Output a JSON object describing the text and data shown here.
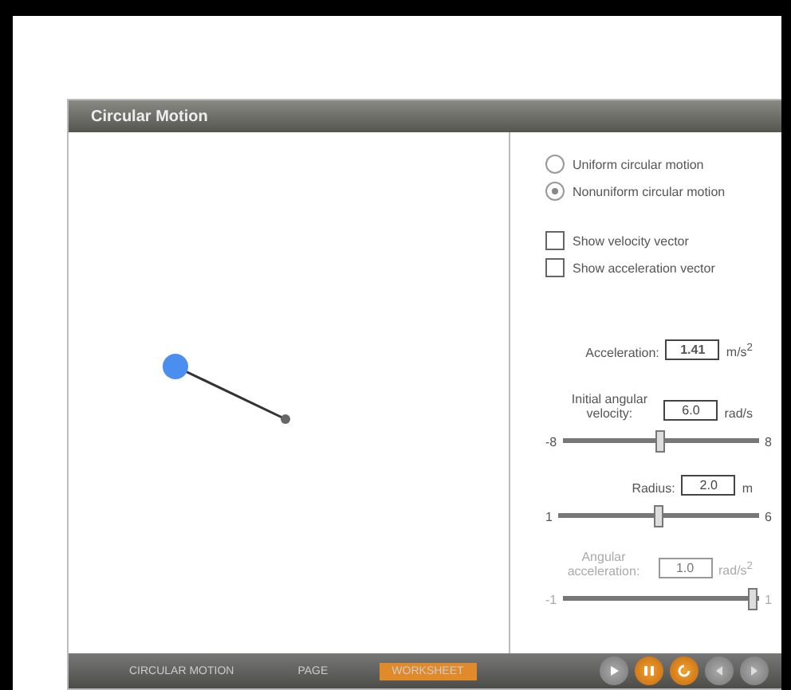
{
  "window": {
    "title": "Circular Motion"
  },
  "motion_modes": [
    {
      "label": "Uniform circular motion",
      "selected": false
    },
    {
      "label": "Nonuniform circular motion",
      "selected": true
    }
  ],
  "vectors": [
    {
      "label": "Show velocity vector",
      "checked": false
    },
    {
      "label": "Show acceleration vector",
      "checked": false
    }
  ],
  "acceleration": {
    "label": "Acceleration:",
    "value": "1.41",
    "unit": "m/s$^{2}$"
  },
  "parameters": [
    {
      "label": "Initial angular velocity:",
      "value": "6.0",
      "unit": "rad/s",
      "min": "-8",
      "max": "8",
      "level": 0.5,
      "disabled": false
    },
    {
      "label": "Radius:",
      "value": "2.0",
      "unit": "m",
      "min": "1",
      "max": "6",
      "level": 0.5,
      "disabled": false
    },
    {
      "label": "Angular acceleration:",
      "value": "1.0",
      "unit": "rad/s$^{2}$",
      "min": "-1",
      "max": "1",
      "level": 0.97,
      "disabled": true
    }
  ],
  "footer": {
    "tabs": [
      {
        "label": "CIRCULAR MOTION",
        "selected": false
      },
      {
        "label": "PAGE",
        "selected": false
      },
      {
        "label": "WORKSHEET",
        "selected": true
      }
    ],
    "controls": [
      {
        "kind": "play",
        "active": false
      },
      {
        "kind": "pause",
        "active": true
      },
      {
        "kind": "reset",
        "active": true
      },
      {
        "kind": "back",
        "active": false
      },
      {
        "kind": "forward",
        "active": false
      }
    ]
  }
}
